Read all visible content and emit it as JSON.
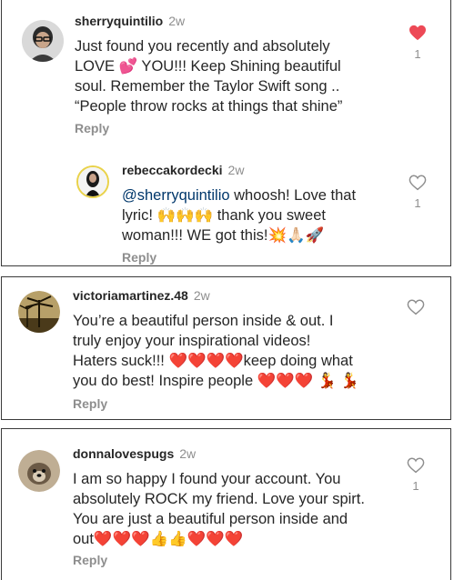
{
  "comments": [
    {
      "username": "sherryquintilio",
      "time": "2w",
      "lines": [
        "Just found you recently and absolutely",
        "LOVE 💕 YOU!!! Keep Shining beautiful",
        "soul. Remember the Taylor Swift song ..",
        "“People throw rocks at things that shine”"
      ],
      "reply": "Reply",
      "likes": "1",
      "liked": true
    },
    {
      "username": "rebeccakordecki",
      "time": "2w",
      "mention": "@sherryquintilio",
      "line1_rest": " whoosh! Love that",
      "lines": [
        "lyric! 🙌🙌🙌 thank you sweet",
        "woman!!! WE got this!💥🙏🏻🚀"
      ],
      "reply": "Reply",
      "likes": "1",
      "liked": false
    },
    {
      "username": "victoriamartinez.48",
      "time": "2w",
      "lines": [
        "You’re a beautiful person inside & out. I",
        "truly enjoy your inspirational videos!",
        "Haters suck!!! ❤️❤️❤️❤️keep doing what",
        "you do best!  Inspire people ❤️❤️❤️ 💃 💃"
      ],
      "reply": "Reply",
      "likes": "",
      "liked": false
    },
    {
      "username": "donnalovespugs",
      "time": "2w",
      "lines": [
        "I am so happy I found your account.  You",
        "absolutely ROCK my friend.  Love your spirt.",
        "You are just a beautiful person inside and",
        "out❤️❤️❤️👍👍❤️❤️❤️"
      ],
      "reply": "Reply",
      "likes": "1",
      "liked": false
    }
  ],
  "colors": {
    "heart_filled": "#ed4956",
    "username": "#262626",
    "muted": "#8e8e8e",
    "mention": "#00376b",
    "border": "#3a3a3a"
  }
}
